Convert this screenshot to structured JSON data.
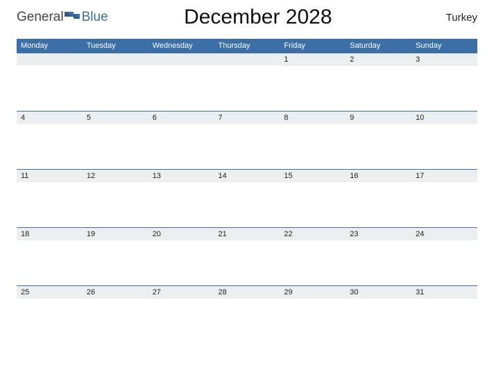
{
  "logo": {
    "word1": "General",
    "word2": "Blue"
  },
  "title": "December 2028",
  "country": "Turkey",
  "weekdays": [
    "Monday",
    "Tuesday",
    "Wednesday",
    "Thursday",
    "Friday",
    "Saturday",
    "Sunday"
  ],
  "weeks": [
    [
      "",
      "",
      "",
      "",
      "1",
      "2",
      "3"
    ],
    [
      "4",
      "5",
      "6",
      "7",
      "8",
      "9",
      "10"
    ],
    [
      "11",
      "12",
      "13",
      "14",
      "15",
      "16",
      "17"
    ],
    [
      "18",
      "19",
      "20",
      "21",
      "22",
      "23",
      "24"
    ],
    [
      "25",
      "26",
      "27",
      "28",
      "29",
      "30",
      "31"
    ]
  ]
}
